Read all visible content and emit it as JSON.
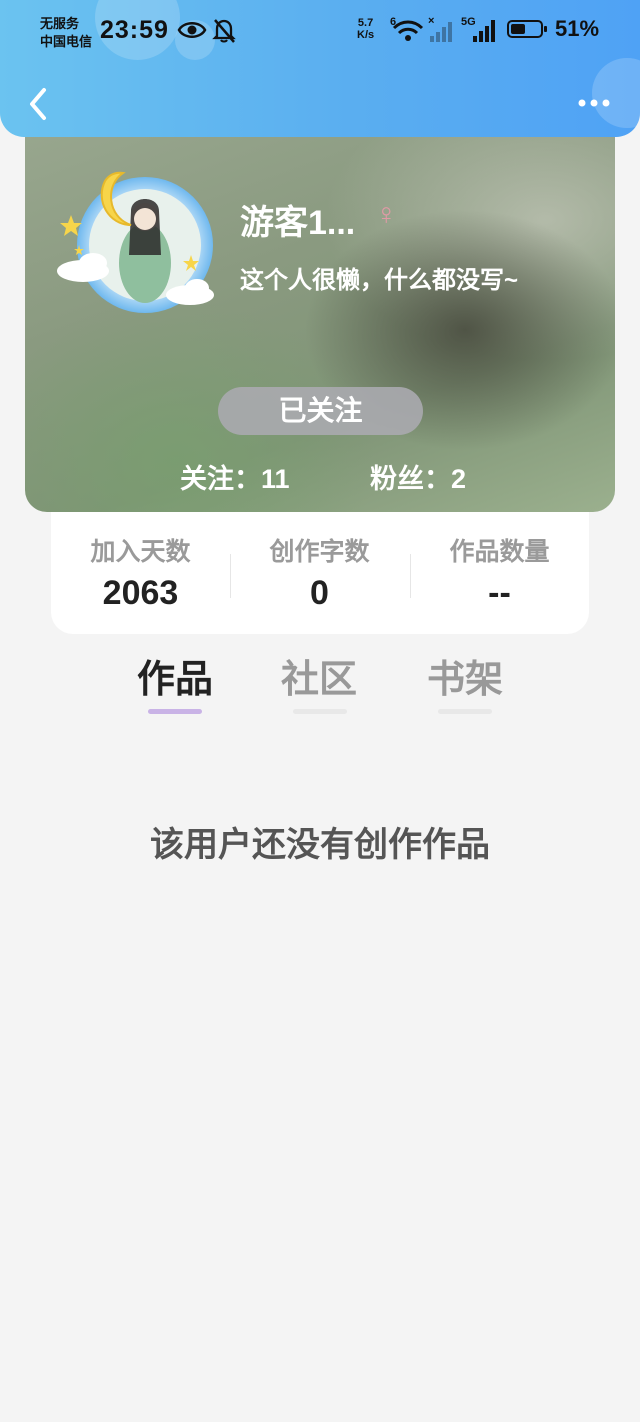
{
  "status_bar": {
    "carrier_line1": "无服务",
    "carrier_line2": "中国电信",
    "time": "23:59",
    "net_speed_value": "5.7",
    "net_speed_unit": "K/s",
    "wifi_badge": "6",
    "signal_badge": "5G",
    "battery": "51%",
    "battery_level_fraction": 0.51
  },
  "profile": {
    "nickname": "游客1...",
    "gender_symbol": "♀",
    "bio": "这个人很懒，什么都没写~",
    "follow_button": "已关注",
    "following": "关注：11",
    "fans": "粉丝：2"
  },
  "stats": [
    {
      "label": "加入天数",
      "value": "2063"
    },
    {
      "label": "创作字数",
      "value": "0"
    },
    {
      "label": "作品数量",
      "value": "--"
    }
  ],
  "tabs": [
    {
      "label": "作品",
      "active": true
    },
    {
      "label": "社区",
      "active": false
    },
    {
      "label": "书架",
      "active": false
    }
  ],
  "empty_message": "该用户还没有创作作品",
  "colors": {
    "header_start": "#6bc3f0",
    "header_end": "#4fa2f5",
    "tab_indicator": "#c9b3e6",
    "tab_active_text": "#222222",
    "tab_inactive_text": "#999999",
    "gender": "#e09aa6"
  }
}
